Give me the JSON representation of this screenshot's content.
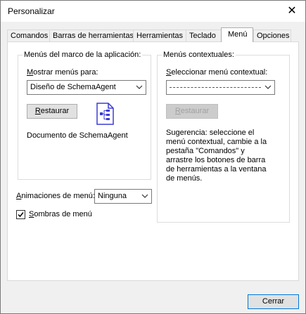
{
  "window": {
    "title": "Personalizar",
    "close_glyph": "✕"
  },
  "tabs": [
    {
      "label": "Comandos",
      "active": false
    },
    {
      "label": "Barras de herramientas",
      "active": false
    },
    {
      "label": "Herramientas",
      "active": false
    },
    {
      "label": "Teclado",
      "active": false
    },
    {
      "label": "Menú",
      "active": true
    },
    {
      "label": "Opciones",
      "active": false
    }
  ],
  "frame_menus": {
    "group_label": "Menús del marco de la aplicación:",
    "show_for_label": "Mostrar menús para:",
    "show_for_value": "Diseño de SchemaAgent",
    "reset_label": "Restaurar",
    "document_label": "Documento de SchemaAgent",
    "icon": "schemaagent-document-icon"
  },
  "context_menus": {
    "group_label": "Menús contextuales:",
    "select_label": "Seleccionar menú contextual:",
    "select_value": "",
    "reset_label": "Restaurar",
    "hint": "Sugerencia: seleccione el menú contextual, cambie a la pestaña \"Comandos\" y arrastre los botones de barra de herramientas a la ventana de menús."
  },
  "animations": {
    "label": "Animaciones de menú:",
    "value": "Ninguna"
  },
  "shadows": {
    "label": "Sombras de menú",
    "checked": true
  },
  "footer": {
    "close_label": "Cerrar"
  },
  "colors": {
    "accent": "#0078d7",
    "icon_blue": "#3b3bd6"
  }
}
